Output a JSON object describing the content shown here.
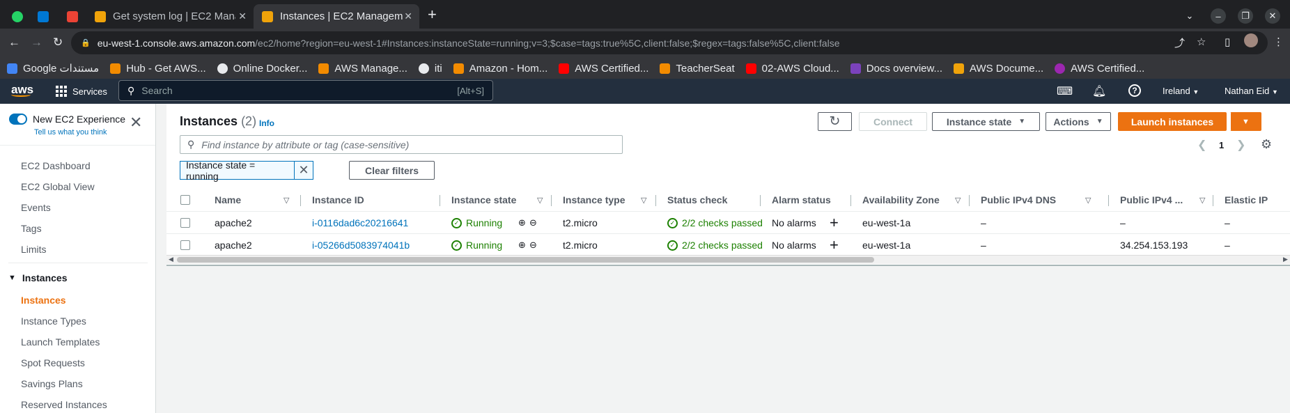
{
  "browser": {
    "tabs": [
      {
        "title": "Get system log | EC2 Mana",
        "active": false
      },
      {
        "title": "Instances | EC2 Managem",
        "active": true
      }
    ],
    "url_host": "eu-west-1.console.aws.amazon.com",
    "url_path": "/ec2/home?region=eu-west-1#Instances:instanceState=running;v=3;$case=tags:true%5C,client:false;$regex=tags:false%5C,client:false",
    "bookmarks": [
      "Google مستندات",
      "Hub - Get AWS...",
      "Online Docker...",
      "AWS Manage...",
      "iti",
      "Amazon - Hom...",
      "AWS Certified...",
      "TeacherSeat",
      "02-AWS Cloud...",
      "Docs overview...",
      "AWS Docume...",
      "AWS Certified..."
    ]
  },
  "awsnav": {
    "logo": "aws",
    "services": "Services",
    "search_placeholder": "Search",
    "search_shortcut": "[Alt+S]",
    "region": "Ireland",
    "user": "Nathan Eid"
  },
  "sidebar": {
    "toggle_label": "New EC2 Experience",
    "toggle_sub": "Tell us what you think",
    "items": [
      "EC2 Dashboard",
      "EC2 Global View",
      "Events",
      "Tags",
      "Limits"
    ],
    "section": "Instances",
    "section_items": [
      "Instances",
      "Instance Types",
      "Launch Templates",
      "Spot Requests",
      "Savings Plans",
      "Reserved Instances"
    ]
  },
  "panel": {
    "title": "Instances",
    "count": "(2)",
    "info": "Info",
    "connect": "Connect",
    "instance_state": "Instance state",
    "actions": "Actions",
    "launch": "Launch instances",
    "filter_placeholder": "Find instance by attribute or tag (case-sensitive)",
    "page": "1",
    "token": "Instance state = running",
    "clear_filters": "Clear filters"
  },
  "table": {
    "columns": [
      "Name",
      "Instance ID",
      "Instance state",
      "Instance type",
      "Status check",
      "Alarm status",
      "Availability Zone",
      "Public IPv4 DNS",
      "Public IPv4 ...",
      "Elastic IP"
    ],
    "rows": [
      {
        "name": "apache2",
        "id": "i-0116dad6c20216641",
        "state": "Running",
        "type": "t2.micro",
        "status": "2/2 checks passed",
        "alarm": "No alarms",
        "az": "eu-west-1a",
        "dns": "–",
        "ip": "–",
        "eip": "–"
      },
      {
        "name": "apache2",
        "id": "i-05266d5083974041b",
        "state": "Running",
        "type": "t2.micro",
        "status": "2/2 checks passed",
        "alarm": "No alarms",
        "az": "eu-west-1a",
        "dns": "–",
        "ip": "34.254.153.193",
        "eip": "–"
      }
    ]
  },
  "colors": {
    "aws_orange": "#ec7211",
    "aws_nav": "#232f3e",
    "link_blue": "#0073bb",
    "success_green": "#1d8102"
  }
}
